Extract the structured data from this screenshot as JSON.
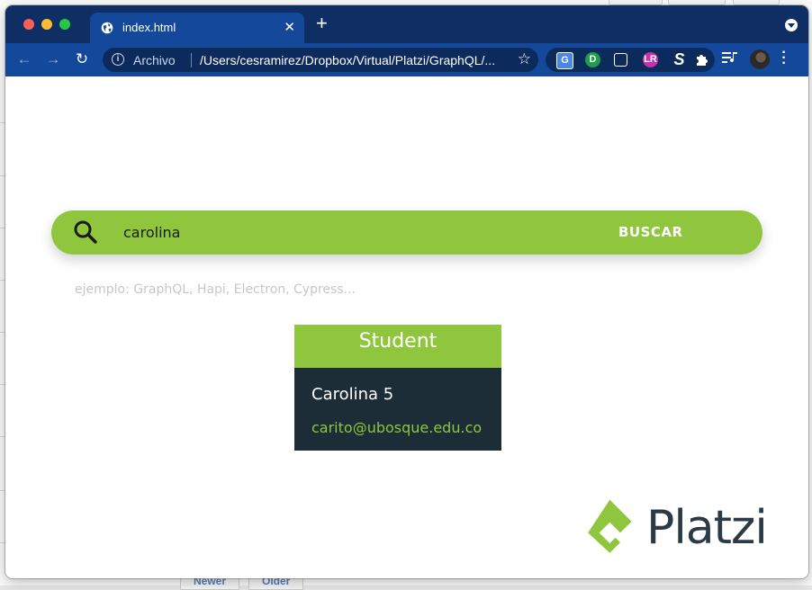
{
  "browser": {
    "tab": {
      "title": "index.html"
    },
    "address_bar": {
      "scheme_label": "Archivo",
      "url": "/Users/cesramirez/Dropbox/Virtual/Platzi/GraphQL/..."
    }
  },
  "search": {
    "value": "carolina",
    "button_label": "BUSCAR",
    "hint": "ejemplo: GraphQL, Hapi, Electron, Cypress..."
  },
  "result_card": {
    "type": "Student",
    "name": "Carolina 5",
    "email": "carito@ubosque.edu.co"
  },
  "brand": {
    "name": "Platzi"
  },
  "background_page": {
    "buttons": [
      "Newer",
      "Older"
    ]
  },
  "colors": {
    "accent_green": "#8fc63d",
    "card_dark": "#1c2d37",
    "browser_blue": "#14489a"
  }
}
